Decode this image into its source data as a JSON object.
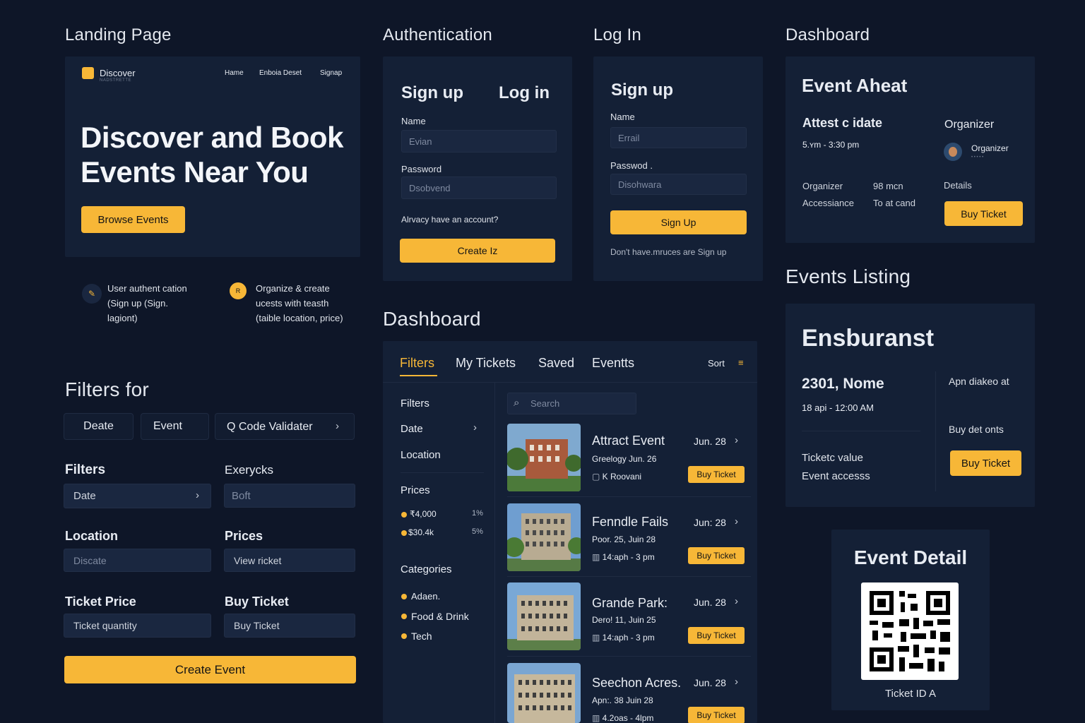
{
  "sections": {
    "landing": "Landing Page",
    "auth": "Authentication",
    "login": "Log In",
    "dashboard_top": "Dashboard",
    "dashboard_mid": "Dashboard",
    "events_listing": "Events Listing",
    "filters": "Filters for"
  },
  "landing": {
    "brand": "Discover",
    "brand_sub": "NADSTRETTE",
    "nav": [
      "Hame",
      "Enboia Deset",
      "Signap"
    ],
    "hero": "Discover and Book Events Near You",
    "hero_line1": "Discover and Book",
    "hero_line2": "Events Near You",
    "cta": "Browse Events",
    "feature1_l1": "User authent cation",
    "feature1_l2": "(Sign up (Sign.",
    "feature1_l3": "lagiont)",
    "feature2_icon": "R",
    "feature2_l1": "Organize & create",
    "feature2_l2": "ucests with teasth",
    "feature2_l3": "(taible location, price)"
  },
  "auth": {
    "tab_signup": "Sign up",
    "tab_login": "Log in",
    "name_label": "Name",
    "name_value": "Evian",
    "password_label": "Password",
    "password_value": "Dsobvend",
    "have_account": "Alrvacy have an account?",
    "create_btn": "Create Iz"
  },
  "login": {
    "title": "Sign up",
    "name_label": "Name",
    "email_value": "Errail",
    "password_label": "Passwod .",
    "password_value": "Disohwara",
    "signup_btn": "Sign Up",
    "footer": "Don't have.mruces are Sign up"
  },
  "dash_top": {
    "title": "Event Aheat",
    "subtitle": "Attest c idate",
    "time": "5.ʏm - 3:30 pm",
    "organizer_head": "Organizer",
    "organizer_name": "Organizer",
    "organizer_sub": "• • • • •",
    "row1_label": "Organizer",
    "row1_value": "98 mcn",
    "row2_label": "Accessiance",
    "row2_value": "To at cand",
    "details": "Details",
    "buy": "Buy Ticket"
  },
  "listing": {
    "title": "Ensburanst",
    "venue": "2301, Nome",
    "date": "18 api - 12:00 AM",
    "right_top": "Apn diakeo at",
    "right_mid": "Buy det onts",
    "value": "Ticketc value",
    "access": "Event accesss",
    "buy": "Buy Ticket"
  },
  "detail": {
    "title": "Event Detail",
    "ticket_id": "Ticket ID A"
  },
  "filters": {
    "chips": [
      "Deate",
      "Event",
      "Q Code Validater"
    ],
    "filters_head": "Filters",
    "everycks": "Exerycks",
    "date_field": "Date",
    "boft": "Boft",
    "location_head": "Location",
    "prices_head": "Prices",
    "location_placeholder": "Discate",
    "view_ticket": "View ricket",
    "ticket_price_head": "Ticket Price",
    "buy_ticket_head": "Buy Ticket",
    "ticket_quantity": "Ticket quantity",
    "buy_ticket_field": "Buy Ticket",
    "create_event": "Create Event"
  },
  "dash_mid": {
    "tabs": [
      "Filters",
      "My Tickets",
      "Saved",
      "Eventts"
    ],
    "sort": "Sort",
    "side": {
      "filters": "Filters",
      "date": "Date",
      "location": "Location",
      "prices": "Prices",
      "price1": "₹4,000",
      "price1_pct": "1%",
      "price2": "$30.4k",
      "price2_pct": "5%",
      "categories": "Categories",
      "cats": [
        "Adaen.",
        "Food & Drink",
        "Tech"
      ]
    },
    "search_placeholder": "Search",
    "events": [
      {
        "title": "Attract Event",
        "date": "Jun. 28",
        "sub": "Greelogy Jun. 26",
        "meta": "K Roovani",
        "buy": "Buy Ticket"
      },
      {
        "title": "Fenndle Fails",
        "date": "Jun: 28",
        "sub": "Poor. 25, Juin 28",
        "meta": "14:aph - 3 pm",
        "buy": "Buy Ticket"
      },
      {
        "title": "Grande Park:",
        "date": "Jun. 28",
        "sub": "Dero! 11, Juin 25",
        "meta": "14:aph - 3 pm",
        "buy": "Buy Ticket"
      },
      {
        "title": "Seechon Acres.",
        "date": "Jun. 28",
        "sub": "Apn:. 38  Juin 28",
        "meta": "4.2oas - 4lpm",
        "buy": "Buy Ticket"
      }
    ]
  },
  "colors": {
    "accent": "#f7b737",
    "bg": "#0e1628",
    "panel": "#142036"
  }
}
